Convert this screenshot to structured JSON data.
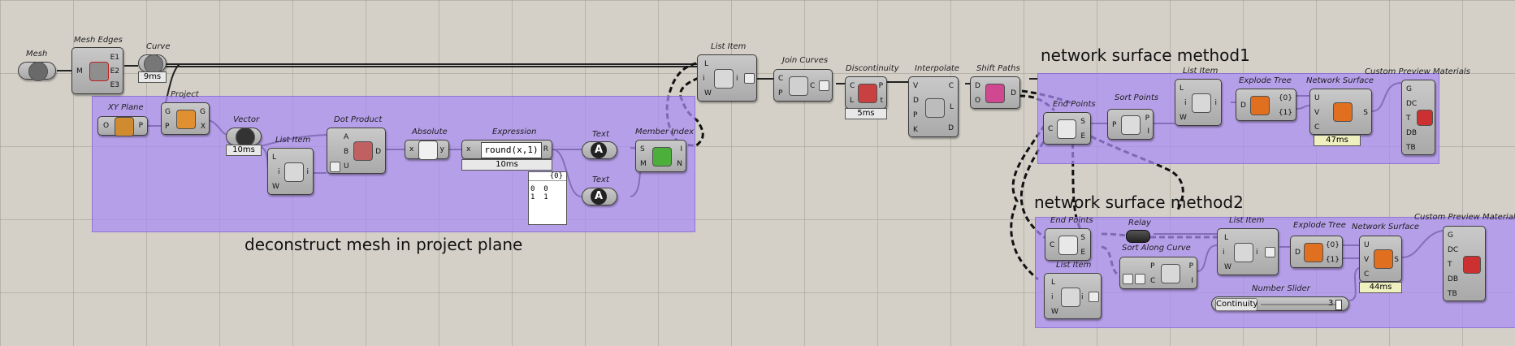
{
  "groups": {
    "project_plane_label": "deconstruct mesh in project plane",
    "method1_label": "network surface method1",
    "method2_label": "network surface method2"
  },
  "components": {
    "mesh": {
      "title": "Mesh"
    },
    "mesh_edges": {
      "title": "Mesh Edges",
      "in": [
        "M"
      ],
      "out": [
        "E1",
        "E2",
        "E3"
      ]
    },
    "curve": {
      "title": "Curve",
      "timer": "9ms"
    },
    "xy_plane": {
      "title": "XY Plane",
      "in": [
        "O"
      ],
      "out": [
        "P"
      ]
    },
    "project": {
      "title": "Project",
      "in": [
        "G",
        "P"
      ],
      "out": [
        "G",
        "X"
      ]
    },
    "vector": {
      "title": "Vector",
      "timer": "10ms"
    },
    "list_item_1": {
      "title": "List Item",
      "in": [
        "L",
        "i",
        "W"
      ],
      "out": [
        "i"
      ]
    },
    "dot_product": {
      "title": "Dot Product",
      "in": [
        "A",
        "B",
        "U"
      ],
      "out": [
        "D"
      ]
    },
    "absolute": {
      "title": "Absolute",
      "in": [
        "x"
      ],
      "out": [
        "y"
      ]
    },
    "expression": {
      "title": "Expression",
      "formula": "round(x,1)",
      "in": [
        "x"
      ],
      "out": [
        "R"
      ],
      "timer": "10ms"
    },
    "text_1": {
      "title": "Text",
      "glyph": "A"
    },
    "text_2": {
      "title": "Text",
      "glyph": "A"
    },
    "member_index": {
      "title": "Member Index",
      "in": [
        "S",
        "M"
      ],
      "out": [
        "I",
        "N"
      ]
    },
    "panel": {
      "header": "{0}",
      "rows": [
        "0  0",
        "1  1"
      ]
    },
    "list_item_top": {
      "title": "List Item",
      "in": [
        "L",
        "i",
        "W"
      ],
      "out": [
        "i"
      ]
    },
    "join_curves": {
      "title": "Join Curves",
      "in": [
        "C",
        "P"
      ],
      "out": [
        "C"
      ]
    },
    "discontinuity": {
      "title": "Discontinuity",
      "in": [
        "C",
        "L"
      ],
      "out": [
        "P",
        "t"
      ],
      "timer": "5ms"
    },
    "interpolate": {
      "title": "Interpolate",
      "in": [
        "V",
        "D",
        "P",
        "K"
      ],
      "out": [
        "C",
        "L",
        "D"
      ]
    },
    "shift_paths": {
      "title": "Shift Paths",
      "in": [
        "D",
        "O"
      ],
      "out": [
        "D"
      ]
    },
    "end_points_1": {
      "title": "End Points",
      "in": [
        "C"
      ],
      "out": [
        "S",
        "E"
      ]
    },
    "sort_points": {
      "title": "Sort Points",
      "in": [
        "P"
      ],
      "out": [
        "P",
        "I"
      ]
    },
    "list_item_m1": {
      "title": "List Item",
      "in": [
        "L",
        "i",
        "W"
      ],
      "out": [
        "i"
      ]
    },
    "explode_tree_1": {
      "title": "Explode Tree",
      "in": [
        "D"
      ],
      "out": [
        "{0}",
        "{1}"
      ]
    },
    "network_surface_1": {
      "title": "Network Surface",
      "in": [
        "U",
        "V",
        "C"
      ],
      "out": [
        "S"
      ],
      "timer": "47ms"
    },
    "custom_preview_1": {
      "title": "Custom Preview Materials",
      "in": [
        "G",
        "DC",
        "T",
        "DB",
        "TB"
      ]
    },
    "end_points_2": {
      "title": "End Points",
      "in": [
        "C"
      ],
      "out": [
        "S",
        "E"
      ]
    },
    "relay": {
      "title": "Relay"
    },
    "list_item_m2a": {
      "title": "List Item",
      "in": [
        "L",
        "i",
        "W"
      ],
      "out": [
        "i"
      ]
    },
    "list_item_m2b": {
      "title": "List Item",
      "in": [
        "L",
        "i",
        "W"
      ],
      "out": [
        "i"
      ]
    },
    "sort_along_curve": {
      "title": "Sort Along Curve",
      "in": [
        "P",
        "C"
      ],
      "out": [
        "P",
        "I"
      ]
    },
    "explode_tree_2": {
      "title": "Explode Tree",
      "in": [
        "D"
      ],
      "out": [
        "{0}",
        "{1}"
      ]
    },
    "network_surface_2": {
      "title": "Network Surface",
      "in": [
        "U",
        "V",
        "C"
      ],
      "out": [
        "S"
      ],
      "timer": "44ms"
    },
    "custom_preview_2": {
      "title": "Custom Preview Materials",
      "in": [
        "G",
        "DC",
        "T",
        "DB",
        "TB"
      ]
    },
    "number_slider": {
      "title": "Number Slider",
      "name": "Continuity",
      "value": "3"
    }
  },
  "colors": {
    "canvas": "#d4d0c8",
    "group": "#aa8cf5",
    "component": "#b4b4b4",
    "wire": "#111111"
  }
}
